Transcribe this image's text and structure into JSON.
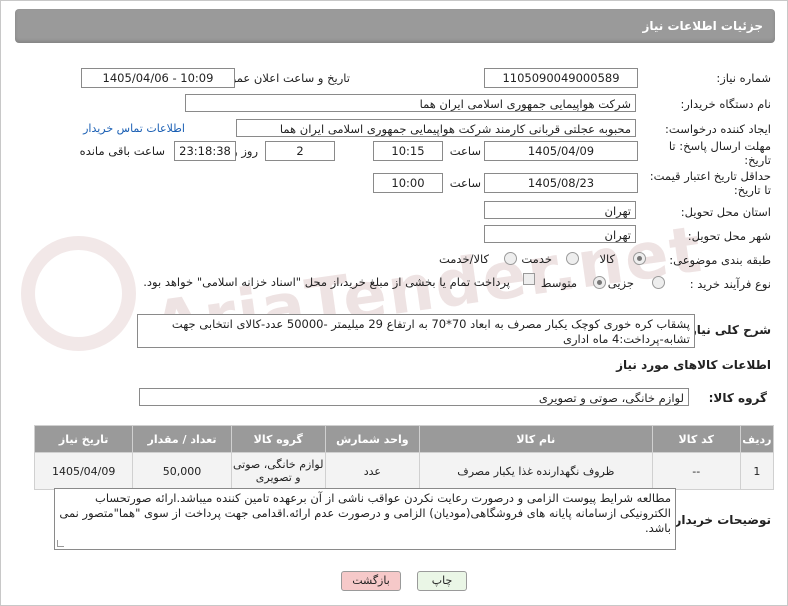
{
  "header": {
    "title": "جزئیات اطلاعات نیاز"
  },
  "form": {
    "need_number_label": "شماره نیاز:",
    "need_number": "1105090049000589",
    "announce_label": "تاریخ و ساعت اعلان عمومی:",
    "announce_value": "1405/04/06 - 10:09",
    "buyer_org_label": "نام دستگاه خریدار:",
    "buyer_org": "شرکت هواپیمایی جمهوری اسلامی ایران هما",
    "creator_label": "ایجاد کننده درخواست:",
    "creator": "محبوبه عجلتی قربانی کارمند شرکت هواپیمایی جمهوری اسلامی ایران هما",
    "contact_link": "اطلاعات تماس خریدار",
    "deadline_label": "مهلت ارسال پاسخ: تا تاریخ:",
    "deadline_date": "1405/04/09",
    "time_label": "ساعت",
    "deadline_time": "10:15",
    "days_value": "2",
    "days_label": "روز و",
    "remaining_value": "23:18:38",
    "remaining_label": "ساعت باقی مانده",
    "price_validity_label": "حداقل تاریخ اعتبار قیمت: تا تاریخ:",
    "price_validity_date": "1405/08/23",
    "price_validity_time": "10:00",
    "province_label": "استان محل تحویل:",
    "province": "تهران",
    "city_label": "شهر محل تحویل:",
    "city": "تهران",
    "category_label": "طبقه بندی موضوعی:",
    "category_options": [
      "کالا",
      "خدمت",
      "کالا/خدمت"
    ],
    "process_label": "نوع فرآیند خرید :",
    "process_options": [
      "جزیی",
      "متوسط"
    ],
    "payment_note": "پرداخت تمام یا بخشی از مبلغ خرید،از محل \"اسناد خزانه اسلامی\" خواهد بود."
  },
  "description": {
    "label": "شرح کلی نیاز:",
    "text": "پشقاب کره خوری کوچک یکبار مصرف به ابعاد 70*70 به ارتفاع 29 میلیمتر -50000 عدد-کالای انتخابی جهت تشابه-پرداخت:4 ماه اداری"
  },
  "goods_info": {
    "title": "اطلاعات کالاهای مورد نیاز",
    "group_label": "گروه کالا:",
    "group_value": "لوازم خانگی، صوتی و تصویری"
  },
  "table": {
    "headers": [
      "ردیف",
      "کد کالا",
      "نام کالا",
      "واحد شمارش",
      "گروه کالا",
      "تعداد / مقدار",
      "تاریخ نیاز"
    ],
    "rows": [
      [
        "1",
        "--",
        "ظروف نگهدارنده غذا یکبار مصرف",
        "عدد",
        "لوازم خانگی، صوتی و تصویری",
        "50,000",
        "1405/04/09"
      ]
    ]
  },
  "buyer_notes": {
    "label": "توضیحات خریدار:",
    "text": "مطالعه شرایط پیوست الزامی و درصورت رعایت نکردن عواقب ناشی از آن برعهده تامین کننده میباشد.ارائه صورتحساب الکترونیکی ازسامانه پایانه های فروشگاهی(مودیان) الزامی و درصورت عدم ارائه.اقدامی جهت پرداخت از سوی \"هما\"متصور نمی باشد."
  },
  "buttons": {
    "print": "چاپ",
    "back": "بازگشت"
  },
  "watermark": {
    "text": "AriaTender.net"
  },
  "colors": {
    "header_bg": "#9a9a9a",
    "link": "#1a5fb4",
    "back_btn": "#f6c9c9",
    "print_btn": "#eaf6e6"
  }
}
